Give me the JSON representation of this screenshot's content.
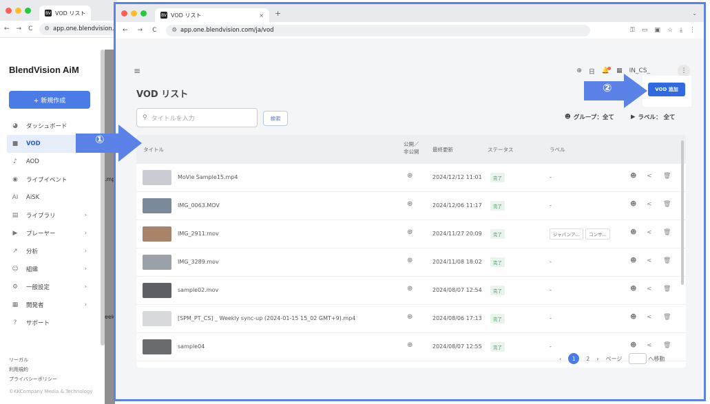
{
  "back_browser": {
    "tab_title": "VOD リスト",
    "url": "app.one.blendvision.c"
  },
  "app": {
    "brand": "BlendVision AiM",
    "new_button": "+ 新規作成",
    "nav": [
      {
        "label": "ダッシュボード",
        "icon": "dashboard-icon",
        "glyph": "◕",
        "chevron": false,
        "active": false
      },
      {
        "label": "VOD",
        "icon": "vod-icon",
        "glyph": "■",
        "chevron": false,
        "active": true
      },
      {
        "label": "AOD",
        "icon": "audio-icon",
        "glyph": "♪",
        "chevron": false,
        "active": false
      },
      {
        "label": "ライブイベント",
        "icon": "live-icon",
        "glyph": "◉",
        "chevron": false,
        "active": false
      },
      {
        "label": "AiSK",
        "icon": "ai-icon",
        "glyph": "AI",
        "chevron": false,
        "active": false
      },
      {
        "label": "ライブラリ",
        "icon": "library-icon",
        "glyph": "▤",
        "chevron": true,
        "active": false
      },
      {
        "label": "プレーヤー",
        "icon": "player-icon",
        "glyph": "▶",
        "chevron": true,
        "active": false
      },
      {
        "label": "分析",
        "icon": "analytics-icon",
        "glyph": "↗",
        "chevron": true,
        "active": false
      },
      {
        "label": "組織",
        "icon": "organization-icon",
        "glyph": "☺",
        "chevron": true,
        "active": false
      },
      {
        "label": "一般設定",
        "icon": "settings-icon",
        "glyph": "⚙",
        "chevron": true,
        "active": false
      },
      {
        "label": "開発者",
        "icon": "developer-icon",
        "glyph": "▦",
        "chevron": true,
        "active": false
      },
      {
        "label": "サポート",
        "icon": "support-icon",
        "glyph": "?",
        "chevron": false,
        "active": false
      }
    ],
    "footer": [
      "リーガル",
      "利用規約",
      "プライバシーポリシー",
      "©KKCompany Media & Technology"
    ],
    "strip_texts": [
      ".mp",
      "eek"
    ]
  },
  "callouts": {
    "one": "①",
    "two": "②"
  },
  "front_browser": {
    "tab_title": "VOD リスト",
    "url": "app.one.blendvision.com/ja/vod"
  },
  "page": {
    "language": "日",
    "user": "IN_CS_",
    "title": "VOD リスト",
    "add_button": "VOD 追加",
    "search_placeholder": "タイトルを入力",
    "search_button": "検索",
    "group_filter": "グループ：全て",
    "label_filter": "ラベル： 全て",
    "columns": {
      "title": "タイトル",
      "visibility": "公開／非公開",
      "updated": "最終更新",
      "status": "ステータス",
      "label": "ラベル"
    },
    "rows": [
      {
        "title": "MoVie Sample15.mp4",
        "updated": "2024/12/12 11:01",
        "status": "完了",
        "labels": [
          "-"
        ],
        "thumb": "#c9ccd2"
      },
      {
        "title": "IMG_0063.MOV",
        "updated": "2024/12/06 11:17",
        "status": "完了",
        "labels": [
          "-"
        ],
        "thumb": "#7b8a9a"
      },
      {
        "title": "IMG_2911.mov",
        "updated": "2024/11/27 20:09",
        "status": "完了",
        "labels": [
          "ジャパンア...",
          "コンサ..."
        ],
        "thumb": "#a8836a"
      },
      {
        "title": "IMG_3289.mov",
        "updated": "2024/11/08 18:02",
        "status": "完了",
        "labels": [
          "-"
        ],
        "thumb": "#9aa1a8"
      },
      {
        "title": "sample02.mov",
        "updated": "2024/08/07 12:54",
        "status": "完了",
        "labels": [
          "-"
        ],
        "thumb": "#5c5f63"
      },
      {
        "title": "[SPM_PT_CS] _ Weekly sync-up (2024-01-15 15_02 GMT+9).mp4",
        "updated": "2024/08/06 17:13",
        "status": "完了",
        "labels": [
          "-"
        ],
        "thumb": "#d7d9dc"
      },
      {
        "title": "sample04",
        "updated": "2024/08/07 12:55",
        "status": "完了",
        "labels": [
          "-"
        ],
        "thumb": "#6a6d70"
      }
    ],
    "pagination": {
      "current": "1",
      "next": "2",
      "page_label": "ページ",
      "go_label": "へ移動"
    }
  }
}
